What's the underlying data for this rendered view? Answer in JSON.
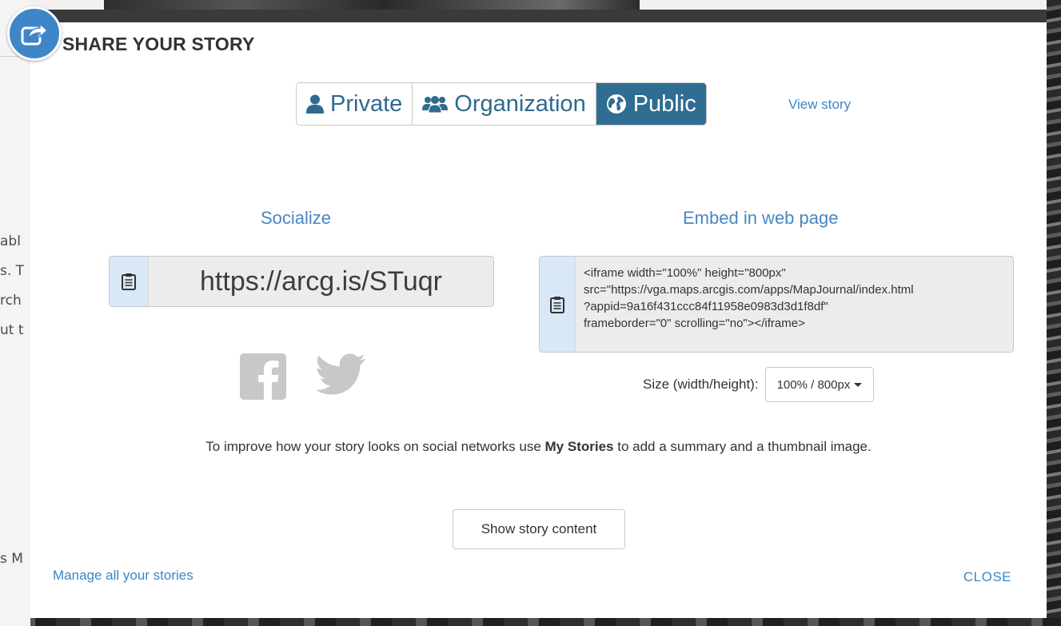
{
  "dialog": {
    "title": "SHARE YOUR STORY",
    "badge_icon": "share-icon",
    "accent_color": "#3e86c7"
  },
  "visibility": {
    "options": [
      {
        "label": "Private",
        "icon": "user-icon",
        "active": false
      },
      {
        "label": "Organization",
        "icon": "group-icon",
        "active": true
      },
      {
        "label": "Public",
        "icon": "globe-icon",
        "active": true
      }
    ],
    "selected": "Public",
    "selected_color": "#2f6d92",
    "view_story_label": "View story"
  },
  "socialize": {
    "heading": "Socialize",
    "short_link": "https://arcg.is/STuqr",
    "copy_icon": "clipboard-icon",
    "networks": [
      "facebook-icon",
      "twitter-icon"
    ]
  },
  "embed": {
    "heading": "Embed in web page",
    "code": "<iframe width=\"100%\" height=\"800px\" src=\"https://vga.maps.arcgis.com/apps/MapJournal/index.html?appid=9a16f431ccc84f11958e0983d3d1f8df\" frameborder=\"0\" scrolling=\"no\"></iframe>",
    "code_lines": [
      "<iframe width=\"100%\" height=\"800px\"",
      "src=\"https://vga.maps.arcgis.com/apps/MapJournal/index.html",
      "?appid=9a16f431ccc84f11958e0983d3d1f8df\"",
      "frameborder=\"0\" scrolling=\"no\"></iframe>"
    ],
    "size_label": "Size (width/height):",
    "size_value": "100% / 800px"
  },
  "tip": {
    "before": "To improve how your story looks on social networks use ",
    "bold": "My Stories",
    "after": " to add a summary and a thumbnail image."
  },
  "buttons": {
    "show_content": "Show story content",
    "manage_all": "Manage all your stories",
    "close": "CLOSE"
  },
  "background_fragments": [
    "abl",
    "s. T",
    "rch",
    "ut t",
    "s M"
  ]
}
